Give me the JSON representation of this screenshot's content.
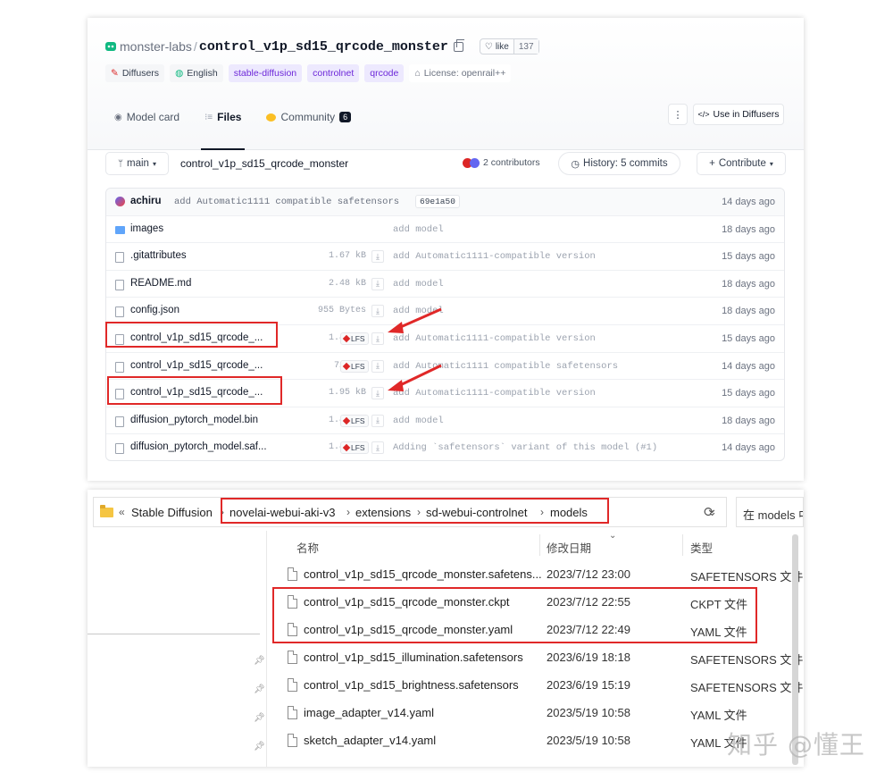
{
  "hf": {
    "org": "monster-labs",
    "repo": "control_v1p_sd15_qrcode_monster",
    "like_label": "like",
    "like_count": "137",
    "tags": [
      {
        "label": "Diffusers",
        "style": "plain"
      },
      {
        "label": "English",
        "style": "plain"
      },
      {
        "label": "stable-diffusion",
        "style": "purple"
      },
      {
        "label": "controlnet",
        "style": "purple"
      },
      {
        "label": "qrcode",
        "style": "purple"
      },
      {
        "label": "License: openrail++",
        "style": "lic"
      }
    ],
    "tabs": {
      "model_card": "Model card",
      "files": "Files",
      "community": "Community",
      "community_count": "6",
      "use_in": "Use in Diffusers"
    },
    "toolbar": {
      "branch": "main",
      "path": "control_v1p_sd15_qrcode_monster",
      "contributors": "2 contributors",
      "history": "History: 5 commits",
      "contribute": "Contribute"
    },
    "last_commit": {
      "author": "achiru",
      "message": "add Automatic1111 compatible safetensors",
      "hash": "69e1a50",
      "date": "14 days ago"
    },
    "files": [
      {
        "name": "images",
        "type": "folder",
        "size": "",
        "lfs": false,
        "message": "add model",
        "date": "18 days ago"
      },
      {
        "name": ".gitattributes",
        "type": "file",
        "size": "1.67 kB",
        "lfs": false,
        "message": "add Automatic1111-compatible version",
        "date": "15 days ago"
      },
      {
        "name": "README.md",
        "type": "file",
        "size": "2.48 kB",
        "lfs": false,
        "message": "add model",
        "date": "18 days ago"
      },
      {
        "name": "config.json",
        "type": "file",
        "size": "955 Bytes",
        "lfs": false,
        "message": "add model",
        "date": "18 days ago"
      },
      {
        "name": "control_v1p_sd15_qrcode_...",
        "type": "file",
        "size": "1.45 GB",
        "lfs": true,
        "message": "add Automatic1111-compatible version",
        "date": "15 days ago"
      },
      {
        "name": "control_v1p_sd15_qrcode_...",
        "type": "file",
        "size": "723 MB",
        "lfs": true,
        "message": "add Automatic1111 compatible safetensors",
        "date": "14 days ago"
      },
      {
        "name": "control_v1p_sd15_qrcode_...",
        "type": "file",
        "size": "1.95 kB",
        "lfs": false,
        "message": "add Automatic1111-compatible version",
        "date": "15 days ago"
      },
      {
        "name": "diffusion_pytorch_model.bin",
        "type": "file",
        "size": "1.45 GB",
        "lfs": true,
        "message": "add model",
        "date": "18 days ago"
      },
      {
        "name": "diffusion_pytorch_model.saf...",
        "type": "file",
        "size": "1.45 GB",
        "lfs": true,
        "message": "Adding `safetensors` variant of this model (#1)",
        "date": "14 days ago"
      }
    ],
    "lfs_label": "LFS"
  },
  "explorer": {
    "breadcrumb": [
      "Stable Diffusion",
      "novelai-webui-aki-v3",
      "extensions",
      "sd-webui-controlnet",
      "models"
    ],
    "search_placeholder": "在 models 中",
    "columns": {
      "name": "名称",
      "date": "修改日期",
      "type": "类型"
    },
    "rows": [
      {
        "name": "control_v1p_sd15_qrcode_monster.safetens...",
        "date": "2023/7/12 23:00",
        "type": "SAFETENSORS 文件"
      },
      {
        "name": "control_v1p_sd15_qrcode_monster.ckpt",
        "date": "2023/7/12 22:55",
        "type": "CKPT 文件"
      },
      {
        "name": "control_v1p_sd15_qrcode_monster.yaml",
        "date": "2023/7/12 22:49",
        "type": "YAML 文件"
      },
      {
        "name": "control_v1p_sd15_illumination.safetensors",
        "date": "2023/6/19 18:18",
        "type": "SAFETENSORS 文件"
      },
      {
        "name": "control_v1p_sd15_brightness.safetensors",
        "date": "2023/6/19 15:19",
        "type": "SAFETENSORS 文件"
      },
      {
        "name": "image_adapter_v14.yaml",
        "date": "2023/5/19 10:58",
        "type": "YAML 文件"
      },
      {
        "name": "sketch_adapter_v14.yaml",
        "date": "2023/5/19 10:58",
        "type": "YAML 文件"
      }
    ]
  },
  "watermark": "知乎 @懂王",
  "colors": {
    "highlight": "#e02828",
    "accent_purple": "#6d28d9",
    "folder": "#f5c542"
  }
}
